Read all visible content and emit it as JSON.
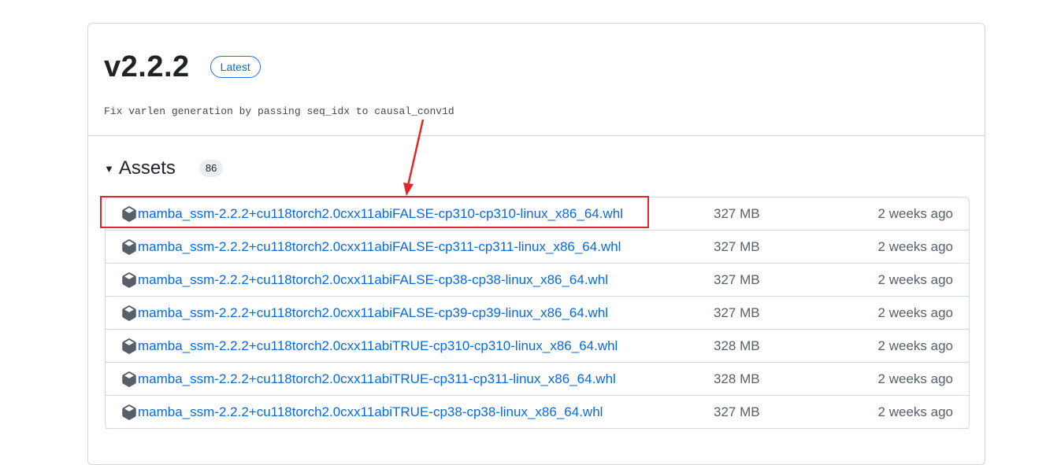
{
  "release": {
    "version": "v2.2.2",
    "badge": "Latest",
    "commit_message": "Fix varlen generation by passing seq_idx to causal_conv1d"
  },
  "assets": {
    "title": "Assets",
    "count": "86",
    "items": [
      {
        "name": "mamba_ssm-2.2.2+cu118torch2.0cxx11abiFALSE-cp310-cp310-linux_x86_64.whl",
        "size": "327 MB",
        "date": "2 weeks ago"
      },
      {
        "name": "mamba_ssm-2.2.2+cu118torch2.0cxx11abiFALSE-cp311-cp311-linux_x86_64.whl",
        "size": "327 MB",
        "date": "2 weeks ago"
      },
      {
        "name": "mamba_ssm-2.2.2+cu118torch2.0cxx11abiFALSE-cp38-cp38-linux_x86_64.whl",
        "size": "327 MB",
        "date": "2 weeks ago"
      },
      {
        "name": "mamba_ssm-2.2.2+cu118torch2.0cxx11abiFALSE-cp39-cp39-linux_x86_64.whl",
        "size": "327 MB",
        "date": "2 weeks ago"
      },
      {
        "name": "mamba_ssm-2.2.2+cu118torch2.0cxx11abiTRUE-cp310-cp310-linux_x86_64.whl",
        "size": "328 MB",
        "date": "2 weeks ago"
      },
      {
        "name": "mamba_ssm-2.2.2+cu118torch2.0cxx11abiTRUE-cp311-cp311-linux_x86_64.whl",
        "size": "328 MB",
        "date": "2 weeks ago"
      },
      {
        "name": "mamba_ssm-2.2.2+cu118torch2.0cxx11abiTRUE-cp38-cp38-linux_x86_64.whl",
        "size": "327 MB",
        "date": "2 weeks ago"
      }
    ]
  },
  "icons": {
    "asset": "package-icon",
    "toggle": "triangle-down-icon"
  },
  "colors": {
    "link": "#0969da",
    "annotation": "#e0262d"
  }
}
